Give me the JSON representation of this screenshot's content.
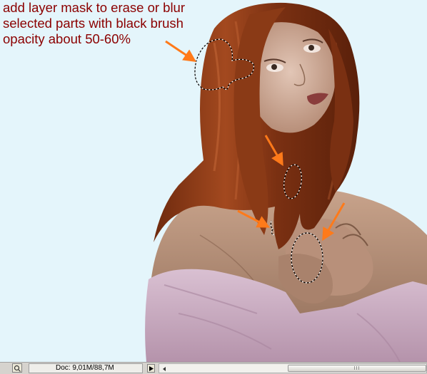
{
  "annotation": {
    "lines": [
      "add layer mask to erase or blur",
      "selected parts with black brush",
      "opacity about 50-60%"
    ]
  },
  "status_bar": {
    "doc_info": "Doc: 9,01M/88,7M",
    "scroll_grip": "III"
  },
  "colors": {
    "background": "#e4f5fb",
    "annotation_text": "#8b0000",
    "arrow": "#ff7a1a",
    "hair": "#8a3a16",
    "skin": "#b08a74",
    "dress": "#cdb0c4"
  },
  "icons": {
    "zoom": "zoom-icon",
    "status_menu": "triangle-right-icon",
    "scroll_left": "arrow-left-icon"
  }
}
